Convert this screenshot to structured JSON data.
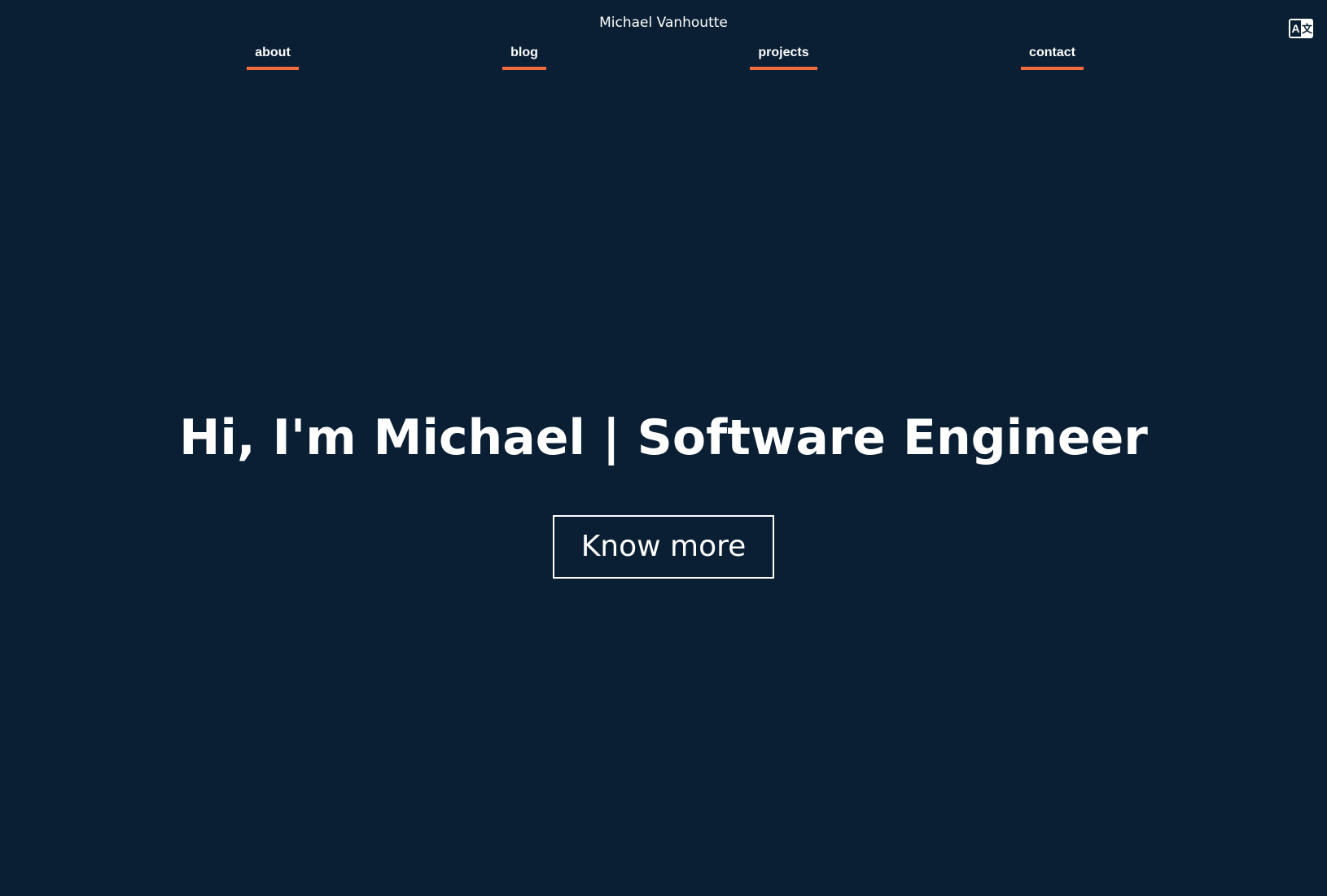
{
  "header": {
    "site_name": "Michael Vanhoutte",
    "language_icon": "translate-icon"
  },
  "nav": {
    "items": [
      {
        "label": "about"
      },
      {
        "label": "blog"
      },
      {
        "label": "projects"
      },
      {
        "label": "contact"
      }
    ]
  },
  "hero": {
    "title": "Hi, I'm Michael | Software Engineer",
    "cta_label": "Know more"
  },
  "colors": {
    "background": "#0a1f33",
    "accent": "#f26a3d",
    "text": "#ffffff"
  }
}
